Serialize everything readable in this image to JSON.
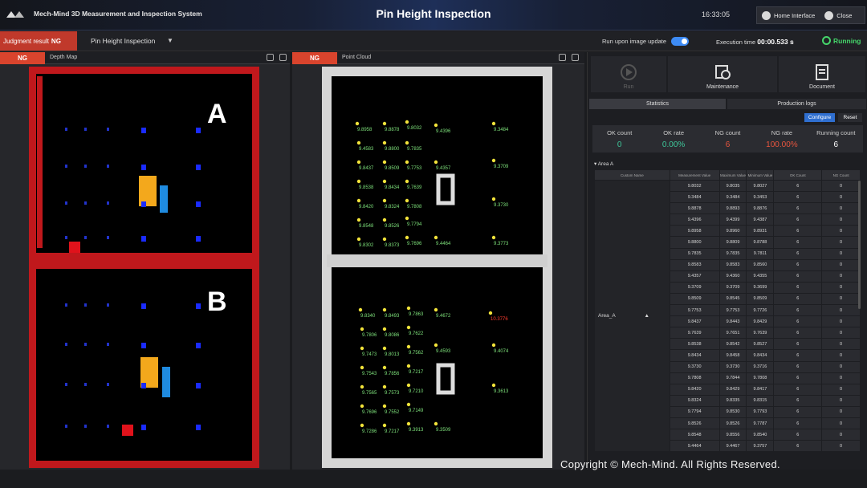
{
  "header": {
    "app_title": "Mech-Mind 3D Measurement and Inspection System",
    "center_title": "Pin Height Inspection",
    "clock": "16:33:05",
    "home_label": "Home Interface",
    "close_label": "Close"
  },
  "toolbar": {
    "judgment_label": "Judgment result",
    "judgment_value": "NG",
    "project": "Pin Height Inspection",
    "run_upon_update": "Run upon image update",
    "run_upon_update_on": true,
    "exec_label": "Execution time",
    "exec_value": "00:00.533 s",
    "status": "Running"
  },
  "depth_panel": {
    "tag": "NG",
    "name": "Depth Map",
    "label_a": "A",
    "label_b": "B"
  },
  "cloud_panel": {
    "tag": "NG",
    "name": "Point Cloud",
    "values_a": [
      "9.8958",
      "9.8878",
      "9.8032",
      "9.4396",
      "9.3484",
      "9.4583",
      "9.8800",
      "9.7835",
      "9.8437",
      "9.8509",
      "9.7753",
      "9.4357",
      "9.3709",
      "9.8538",
      "9.8434",
      "9.7639",
      "9.8420",
      "9.8324",
      "9.7808",
      "9.3730",
      "9.8548",
      "9.8526",
      "9.7794",
      "9.8302",
      "9.8373",
      "9.7696",
      "9.4464",
      "9.3773"
    ],
    "values_b": [
      "9.8340",
      "9.8493",
      "9.7863",
      "9.4672",
      "10.3776",
      "9.7806",
      "9.8086",
      "9.7622",
      "9.7473",
      "9.8013",
      "9.7562",
      "9.4593",
      "9.4074",
      "9.7543",
      "9.7856",
      "9.7217",
      "9.7565",
      "9.7573",
      "9.7210",
      "9.3613",
      "9.7696",
      "9.7552",
      "9.7149",
      "9.7286",
      "9.7217",
      "9.3913",
      "9.3509"
    ]
  },
  "right_panel": {
    "run_label": "Run",
    "maintenance_label": "Maintenance",
    "document_label": "Document",
    "tab_stats": "Statistics",
    "tab_logs": "Production logs",
    "configure": "Configure",
    "reset": "Reset",
    "stats": [
      {
        "k": "OK count",
        "v": "0",
        "color": "#3ec79a"
      },
      {
        "k": "OK rate",
        "v": "0.00%",
        "color": "#3ec79a"
      },
      {
        "k": "NG count",
        "v": "6",
        "color": "#e8553e"
      },
      {
        "k": "NG rate",
        "v": "100.00%",
        "color": "#e8553e"
      },
      {
        "k": "Running count",
        "v": "6",
        "color": "#ffffff"
      }
    ],
    "area_label": "Area A",
    "table_headers": [
      "Custom Name",
      "Measurement Value",
      "Maximum Value",
      "Minimum Value",
      "OK Count",
      "NG Count"
    ],
    "row_name": "Area_A",
    "rows": [
      [
        "9.8032",
        "9.8035",
        "9.8027",
        "6",
        "0"
      ],
      [
        "9.3484",
        "9.3484",
        "9.3453",
        "6",
        "0"
      ],
      [
        "9.8878",
        "9.8893",
        "9.8876",
        "6",
        "0"
      ],
      [
        "9.4396",
        "9.4399",
        "9.4387",
        "6",
        "0"
      ],
      [
        "9.8958",
        "9.8960",
        "9.8931",
        "6",
        "0"
      ],
      [
        "9.8800",
        "9.8809",
        "9.8788",
        "6",
        "0"
      ],
      [
        "9.7835",
        "9.7835",
        "9.7811",
        "6",
        "0"
      ],
      [
        "9.8583",
        "9.8583",
        "9.8560",
        "6",
        "0"
      ],
      [
        "9.4357",
        "9.4360",
        "9.4355",
        "6",
        "0"
      ],
      [
        "9.3709",
        "9.3709",
        "9.3699",
        "6",
        "0"
      ],
      [
        "9.8509",
        "9.8545",
        "9.8509",
        "6",
        "0"
      ],
      [
        "9.7753",
        "9.7753",
        "9.7726",
        "6",
        "0"
      ],
      [
        "9.8437",
        "9.8443",
        "9.8429",
        "6",
        "0"
      ],
      [
        "9.7639",
        "9.7651",
        "9.7639",
        "6",
        "0"
      ],
      [
        "9.8538",
        "9.8542",
        "9.8527",
        "6",
        "0"
      ],
      [
        "9.8434",
        "9.8458",
        "9.8434",
        "6",
        "0"
      ],
      [
        "9.3730",
        "9.3730",
        "9.3716",
        "6",
        "0"
      ],
      [
        "9.7808",
        "9.7844",
        "9.7808",
        "6",
        "0"
      ],
      [
        "9.8420",
        "9.8429",
        "9.8417",
        "6",
        "0"
      ],
      [
        "9.8324",
        "9.8335",
        "9.8315",
        "6",
        "0"
      ],
      [
        "9.7794",
        "9.8530",
        "9.7793",
        "6",
        "0"
      ],
      [
        "9.8526",
        "9.8526",
        "9.7787",
        "6",
        "0"
      ],
      [
        "9.8548",
        "9.8556",
        "9.8540",
        "6",
        "0"
      ],
      [
        "9.4464",
        "9.4467",
        "9.3757",
        "6",
        "0"
      ]
    ]
  },
  "copyright": "Copyright © Mech-Mind. All Rights Reserved."
}
